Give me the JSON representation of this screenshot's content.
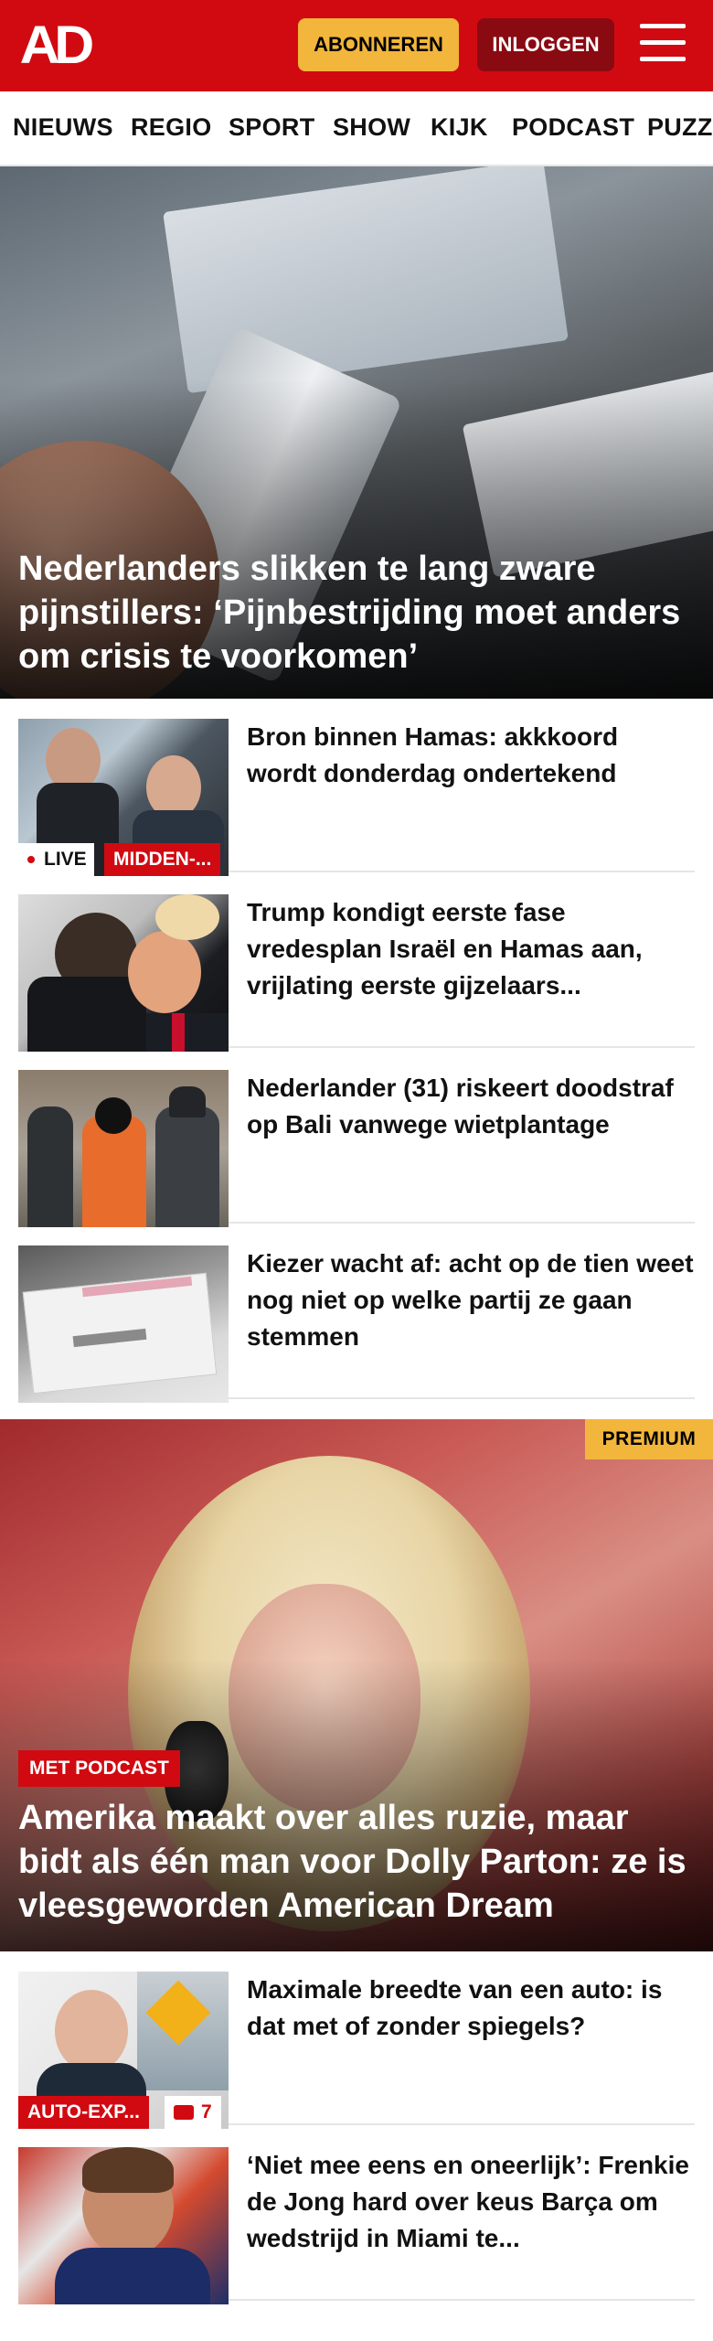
{
  "header": {
    "logo": "AD",
    "subscribe_label": "ABONNEREN",
    "login_label": "INLOGGEN",
    "colors": {
      "brand": "#d10a11",
      "subscribe": "#f2b63c",
      "login": "#8a0a12"
    }
  },
  "nav": {
    "items": [
      "NIEUWS",
      "REGIO",
      "SPORT",
      "SHOW",
      "KIJK",
      "PODCAST",
      "PUZZ"
    ]
  },
  "hero": {
    "title": "Nederlanders slikken te lang zware pijnstillers: ‘Pijnbestrijding moet anders om crisis te voorkomen’"
  },
  "articles": [
    {
      "title": "Bron binnen Hamas: akkkoord wordt donderdag ondertekend",
      "live_label": "LIVE",
      "tag": "MIDDEN-..."
    },
    {
      "title": "Trump kondigt eerste fase vredesplan Israël en Hamas aan, vrijlating eerste gijzelaars..."
    },
    {
      "title": "Nederlander (31) riskeert doodstraf op Bali vanwege wietplantage"
    },
    {
      "title": "Kiezer wacht af: acht op de tien weet nog niet op welke partij ze gaan stemmen"
    }
  ],
  "premium_hero": {
    "premium_label": "PREMIUM",
    "badge": "MET PODCAST",
    "title": "Amerika maakt over alles ruzie, maar bidt als één man voor Dolly Parton: ze is vleesgeworden American Dream"
  },
  "articles2": [
    {
      "title": "Maximale breedte van een auto: is dat met of zonder spiegels?",
      "tag": "AUTO-EXP...",
      "comments": "7"
    },
    {
      "title": "‘Niet mee eens en oneerlijk’: Frenkie de Jong hard over keus Barça om wedstrijd in Miami te..."
    }
  ]
}
